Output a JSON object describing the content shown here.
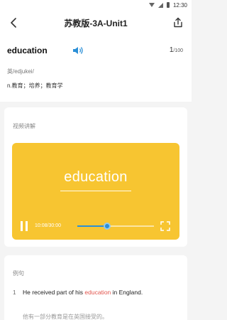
{
  "status_bar": {
    "time": "12:30"
  },
  "nav": {
    "title": "苏教版-3A-Unit1",
    "back_icon": "chevron-left-icon",
    "share_icon": "share-icon"
  },
  "word": {
    "text": "education",
    "current": "1",
    "total": "/100",
    "phonetic": "英/edjukei/",
    "meaning": "n.教育；培养；教育学",
    "speaker_color": "#2b8fd6"
  },
  "video": {
    "label": "视频讲解",
    "word": "education",
    "time": "10:08/30:00",
    "progress": 0.39,
    "bg_color": "#f7c531",
    "accent_color": "#2b8fd6"
  },
  "examples": {
    "label": "例句",
    "items": [
      {
        "num": "1",
        "before": "He received part of his ",
        "highlight": "education",
        "after": " in England.",
        "translation": "他有一部分教育是在英国接受的。",
        "highlight_color": "#e2554d"
      }
    ]
  }
}
